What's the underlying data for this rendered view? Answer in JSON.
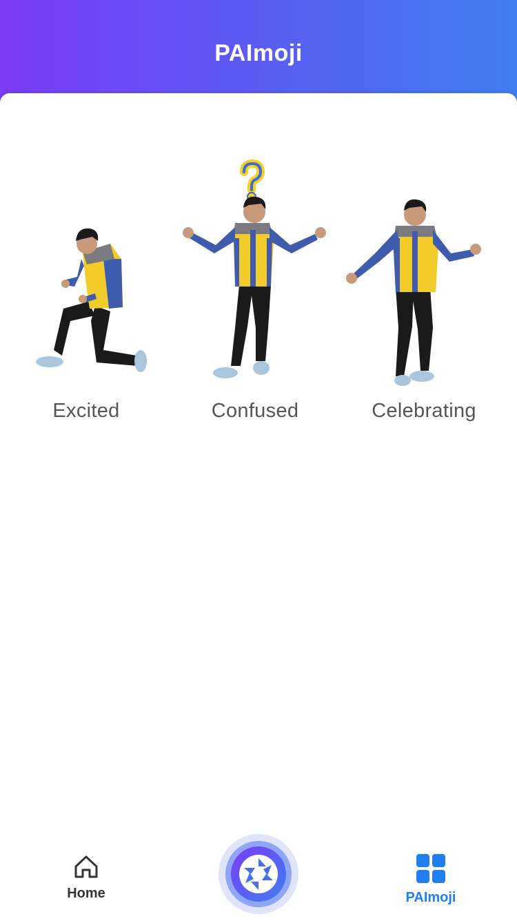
{
  "header": {
    "title": "PAImoji"
  },
  "emojis": [
    {
      "label": "Excited",
      "pose": "kneeling-cheer"
    },
    {
      "label": "Confused",
      "pose": "shrug-question-mark"
    },
    {
      "label": "Celebrating",
      "pose": "dance"
    }
  ],
  "tabbar": {
    "home_label": "Home",
    "paimoji_label": "PAImoji",
    "active_tab": "PAImoji",
    "camera_icon": "aperture-icon"
  },
  "colors": {
    "header_gradient_start": "#7a3cf5",
    "header_gradient_end": "#3f7ef0",
    "active_tab": "#1f7ff0",
    "jacket_body": "#f2cc2a",
    "jacket_sleeves": "#3f5bab",
    "pants": "#1a1a1a",
    "shoes": "#a9c6dd"
  }
}
